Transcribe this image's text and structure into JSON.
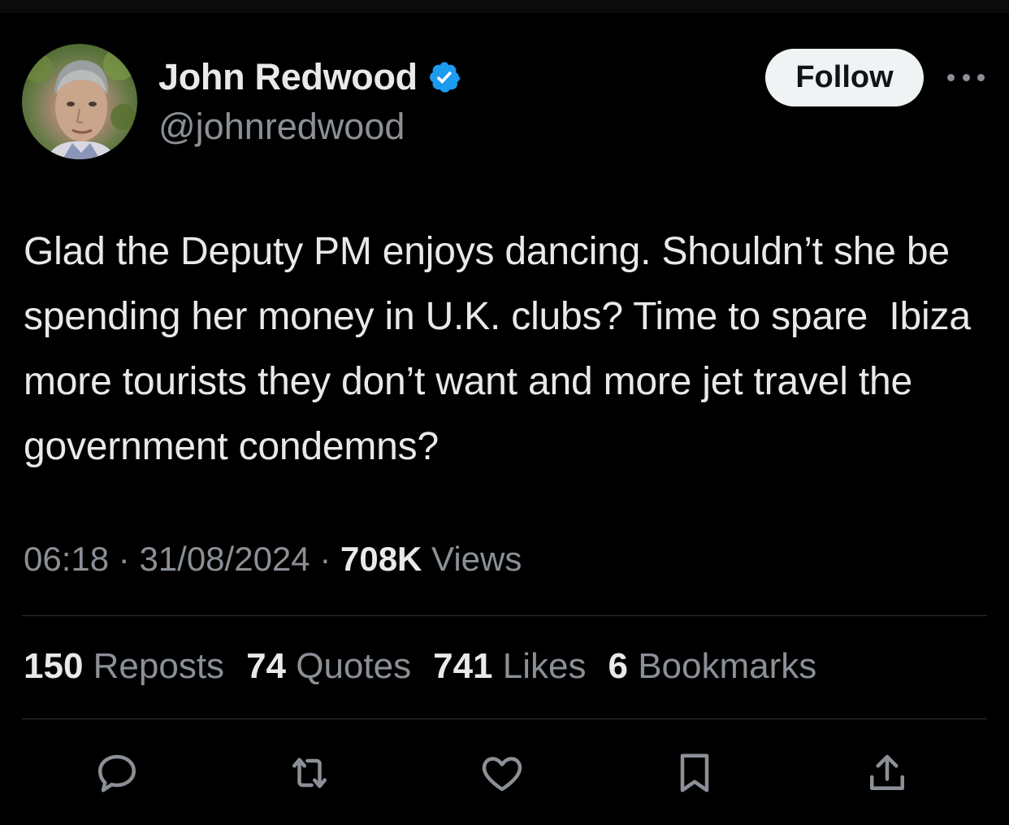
{
  "colors": {
    "background": "#000000",
    "primary_text": "#e7e9ea",
    "secondary_text": "#8b9096",
    "verified_badge": "#1d9bf0",
    "follow_button_bg": "#eff3f4",
    "divider": "#2f3336"
  },
  "author": {
    "name": "John Redwood",
    "handle": "@johnredwood",
    "verified": true,
    "avatar_icon": "profile-photo"
  },
  "header": {
    "follow_label": "Follow",
    "more_icon": "more-horizontal-icon"
  },
  "tweet": {
    "text": "Glad the Deputy PM enjoys dancing. Shouldn’t she be spending her money in U.K. clubs? Time to spare  Ibiza more tourists they don’t want and more jet travel the  government condemns?"
  },
  "meta": {
    "time": "06:18",
    "sep1": " · ",
    "date": "31/08/2024",
    "sep2": " · ",
    "views_count": "708K",
    "views_label": " Views"
  },
  "stats": {
    "reposts_count": "150",
    "reposts_label": " Reposts",
    "quotes_count": "74",
    "quotes_label": " Quotes",
    "likes_count": "741",
    "likes_label": " Likes",
    "bookmarks_count": "6",
    "bookmarks_label": " Bookmarks"
  },
  "actions": [
    "reply-icon",
    "repost-icon",
    "like-icon",
    "bookmark-icon",
    "share-icon"
  ]
}
